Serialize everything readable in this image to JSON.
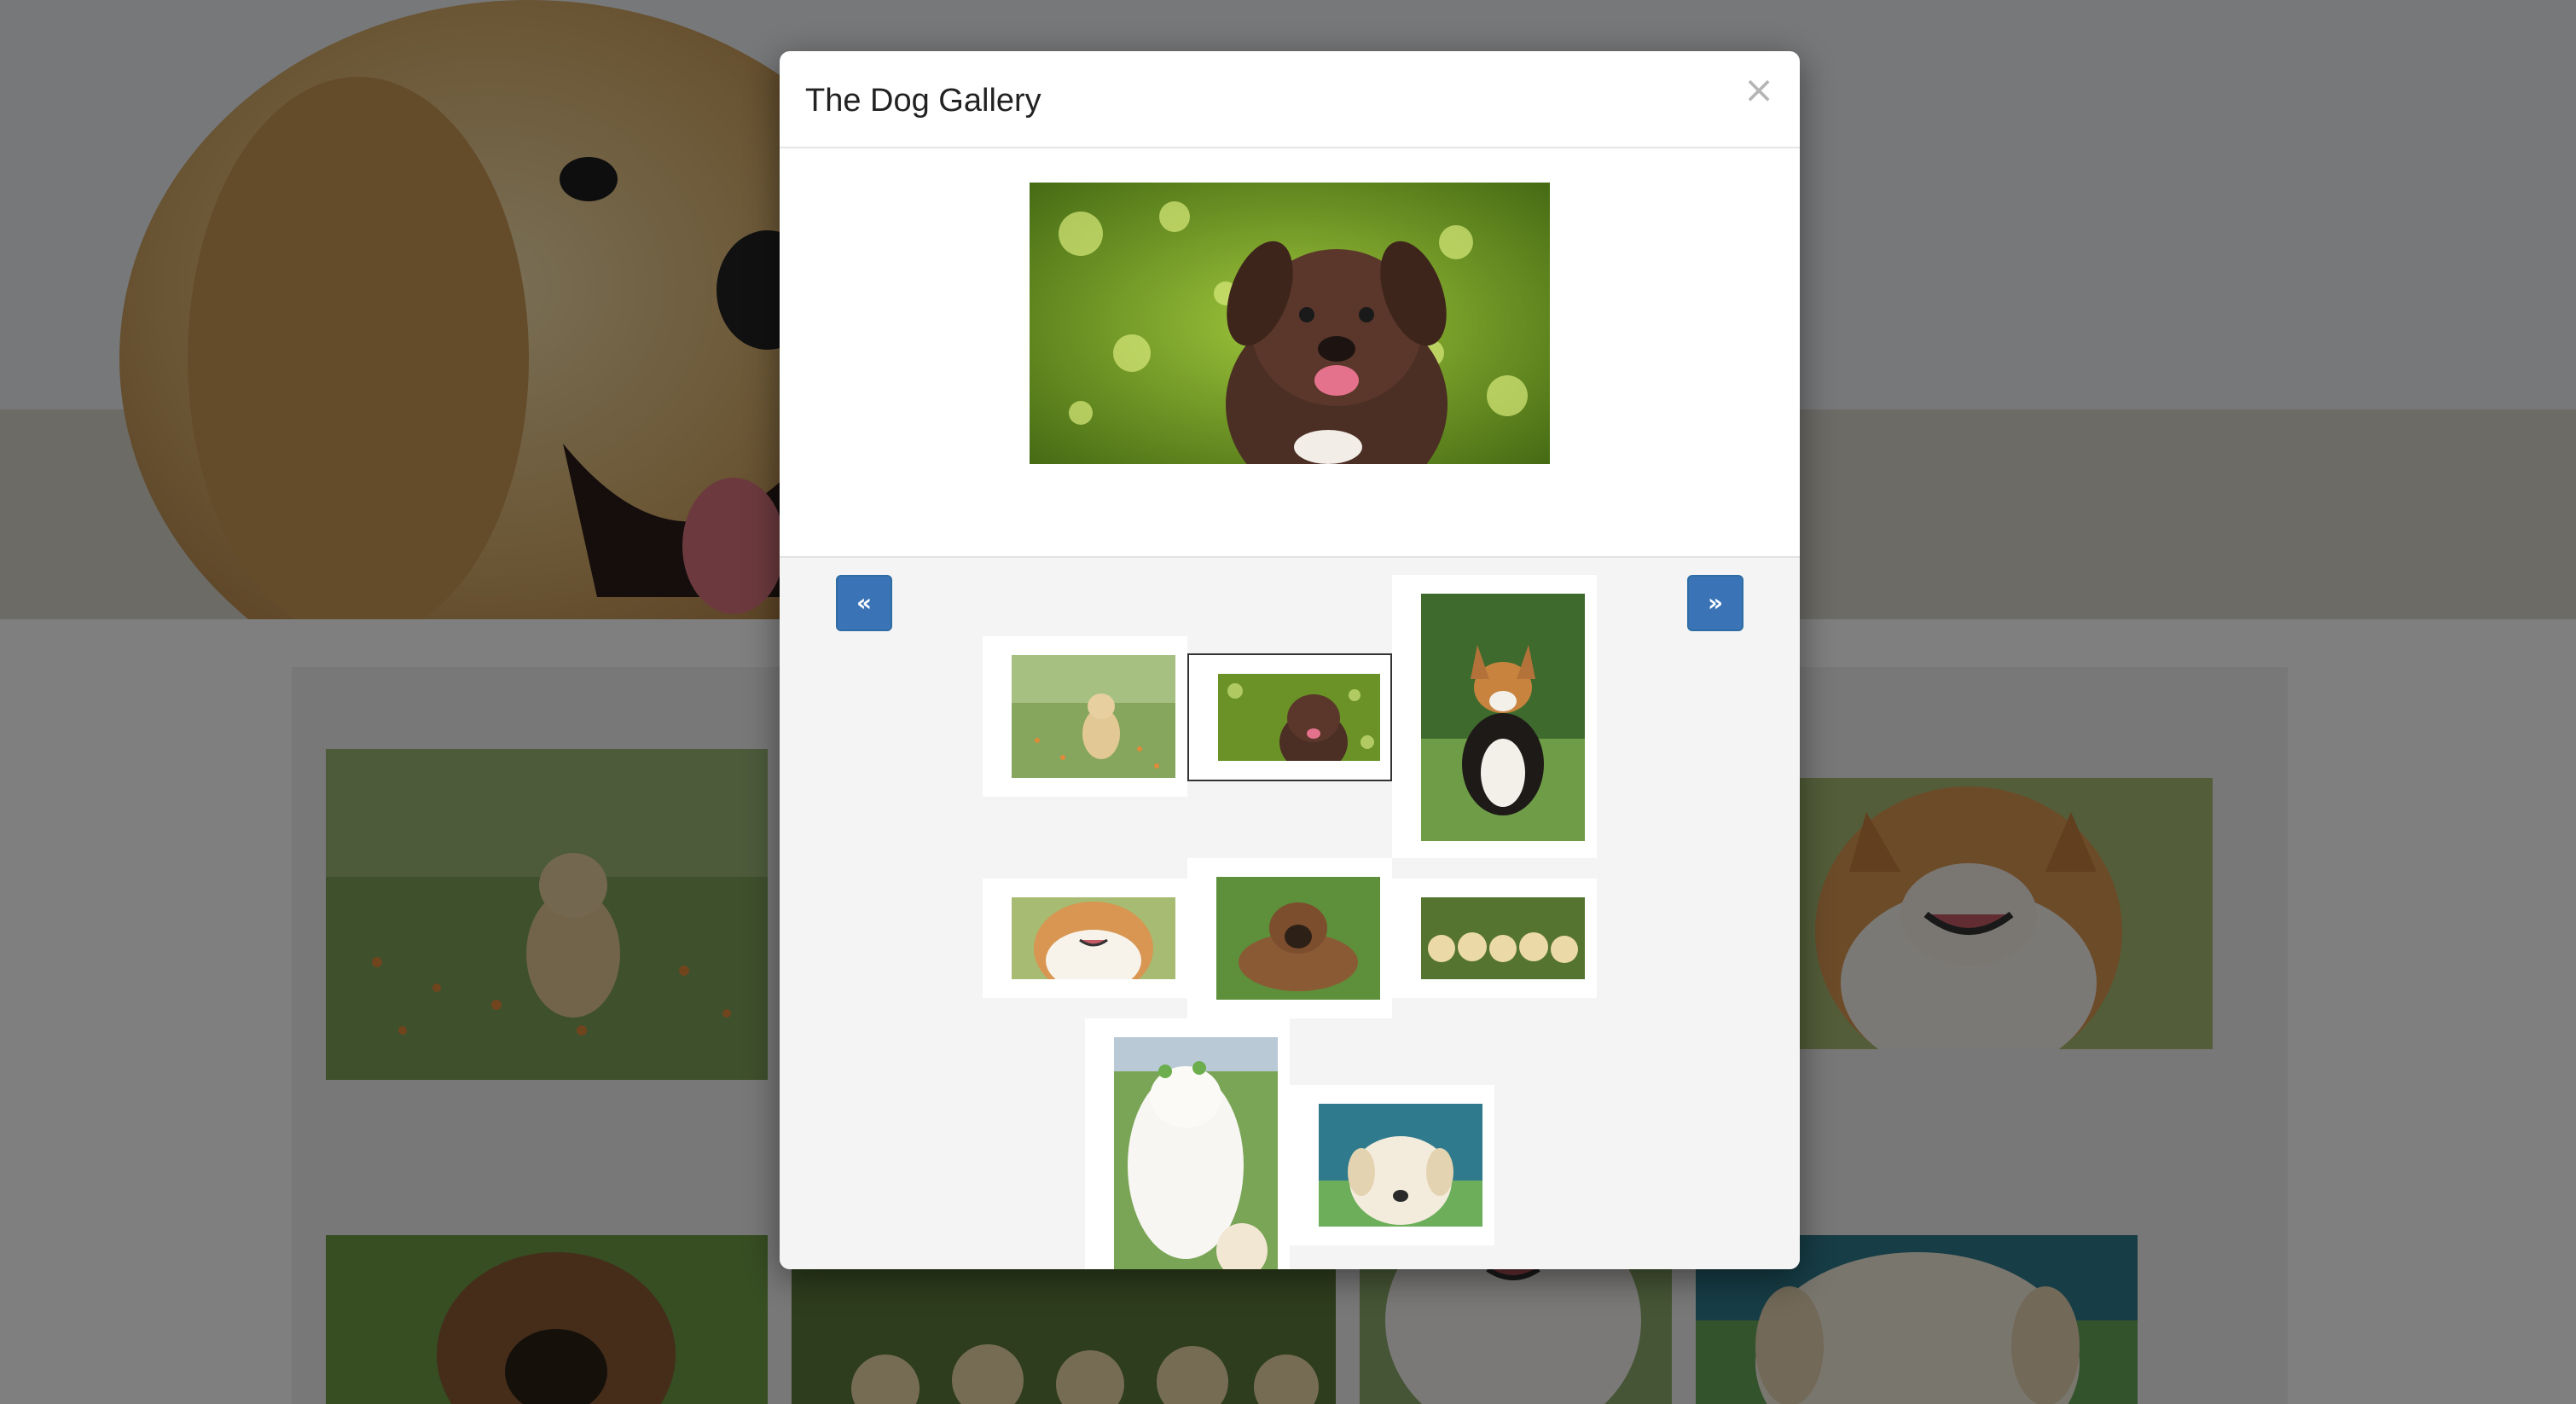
{
  "modal": {
    "title": "The Dog Gallery",
    "close_label": "×",
    "prev_label": "«",
    "next_label": "»"
  },
  "main_image": {
    "icon": "chocolate-puppy-photo",
    "alt": ""
  },
  "thumbnails": [
    {
      "name": "golden-puppy-in-field",
      "active": false
    },
    {
      "name": "chocolate-puppy",
      "active": true
    },
    {
      "name": "corgi-sitting",
      "active": false
    },
    {
      "name": "smiling-corgi",
      "active": false
    },
    {
      "name": "puppy-lying-in-grass",
      "active": false
    },
    {
      "name": "five-golden-puppies",
      "active": false
    },
    {
      "name": "white-spitz-dogs",
      "active": false
    },
    {
      "name": "white-labrador-puppy",
      "active": false
    }
  ],
  "colors": {
    "accent": "#3a74b6",
    "overlay": "rgba(0,0,0,0.5)",
    "footer_bg": "#f4f4f4"
  }
}
